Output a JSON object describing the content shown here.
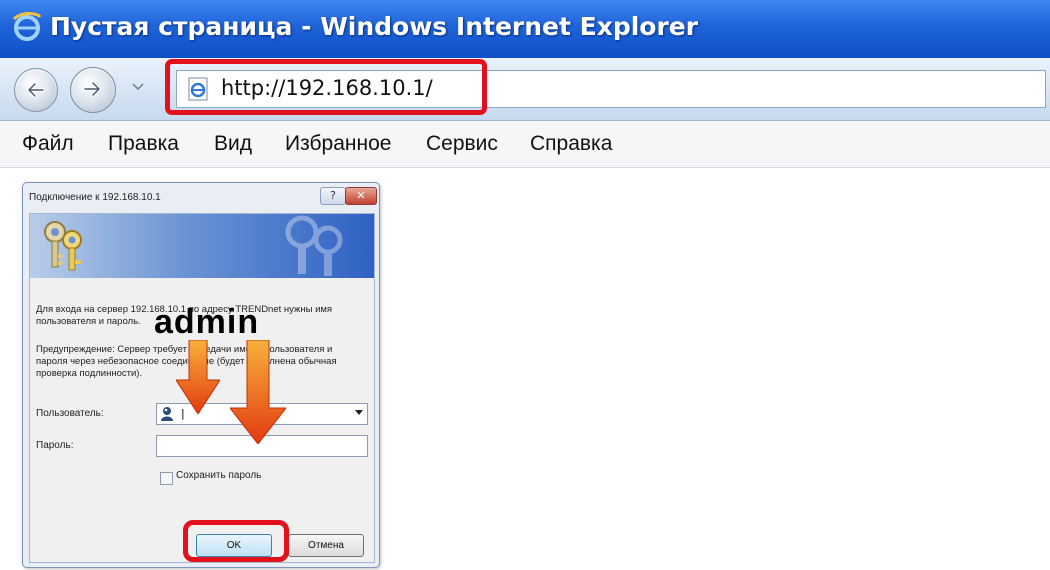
{
  "window": {
    "title": "Пустая страница - Windows Internet Explorer",
    "icon": "ie-logo-icon"
  },
  "navigation": {
    "back_icon": "back-arrow-icon",
    "forward_icon": "forward-arrow-icon",
    "address": "http://192.168.10.1/"
  },
  "menu": {
    "items": [
      "Файл",
      "Правка",
      "Вид",
      "Избранное",
      "Сервис",
      "Справка"
    ]
  },
  "dialog": {
    "title": "Подключение к 192.168.10.1",
    "help_label": "?",
    "close_label": "✕",
    "message": "Для входа на сервер 192.168.10.1 по адресу TRENDnet нужны имя пользователя и пароль.",
    "warning": "Предупреждение: Сервер требует передачи имени пользователя и пароля через небезопасное соединение (будет выполнена обычная проверка подлинности).",
    "user_label": "Пользователь:",
    "user_value": "|",
    "password_label": "Пароль:",
    "save_password_label": "Сохранить пароль",
    "ok_label": "OK",
    "cancel_label": "Отмена"
  },
  "annotation": {
    "text": "admin",
    "highlight_color": "#e3101d",
    "arrow_color": "#f26a10"
  },
  "colors": {
    "titlebar": "#1f63d9",
    "navbar": "#d4e3f4",
    "dialog_banner": "#2f62c4"
  }
}
